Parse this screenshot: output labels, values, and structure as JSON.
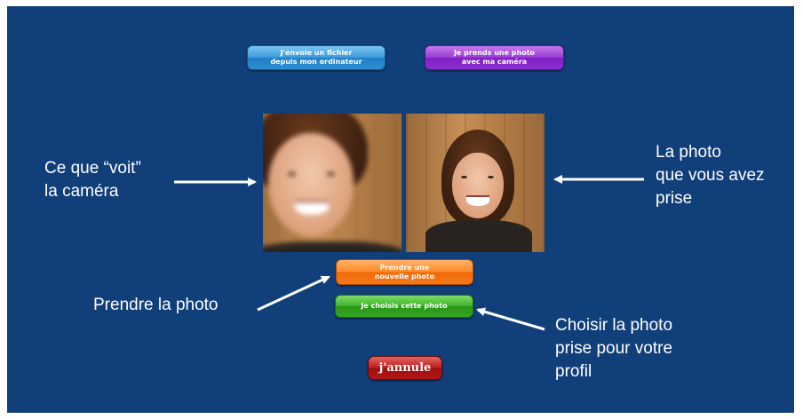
{
  "buttons": {
    "file": {
      "line1": "J'envoie un fichier",
      "line2": "depuis mon ordinateur"
    },
    "camera": {
      "line1": "Je prends une photo",
      "line2": "avec ma caméra"
    },
    "new_photo": {
      "line1": "Prendre une",
      "line2": "nouvelle photo"
    },
    "choose": {
      "label": "Je choisis cette photo"
    },
    "cancel": {
      "label": "j'annule"
    }
  },
  "annotations": {
    "camera_view": "Ce que “voit”\nla caméra",
    "photo_taken": "La photo\nque vous avez\nprise",
    "take_photo": "Prendre la photo",
    "choose_photo": "Choisir la photo\nprise pour votre\nprofil"
  },
  "colors": {
    "background": "#113f7a",
    "file_button": "#2d8ed3",
    "camera_button": "#8c2fd0",
    "new_photo_button": "#f5771a",
    "choose_button": "#34a322",
    "cancel_button": "#b21818"
  }
}
